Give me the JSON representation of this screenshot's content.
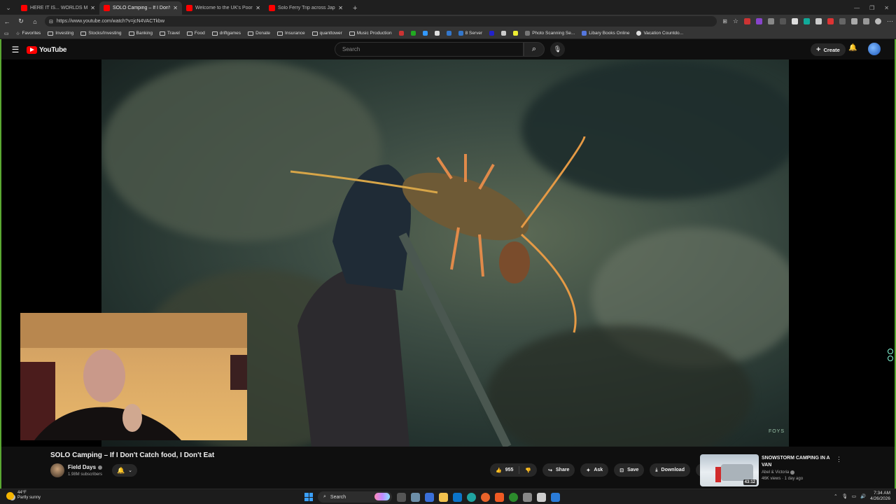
{
  "browser": {
    "tabs": [
      {
        "title": "HERE IT IS... WORLDS MOST INSANE",
        "color": "#ff0000",
        "active": false
      },
      {
        "title": "SOLO Camping – If I Don't Catch Fo",
        "color": "#ff0000",
        "active": true
      },
      {
        "title": "Welcome to the UK's Poorest Town",
        "color": "#ff0000",
        "active": false
      },
      {
        "title": "Solo Ferry Trip across Japan (Kago",
        "color": "#ff0000",
        "active": false
      }
    ],
    "new_tab_label": "+",
    "url": "https://www.youtube.com/watch?v=jcN4VACTkbw",
    "bookmarks": [
      {
        "label": "Favorites",
        "icon": "star-icon"
      },
      {
        "label": "Investing",
        "icon": "folder-icon"
      },
      {
        "label": "Stocks/Investing",
        "icon": "folder-icon"
      },
      {
        "label": "Banking",
        "icon": "folder-icon"
      },
      {
        "label": "Travel",
        "icon": "folder-icon"
      },
      {
        "label": "Food",
        "icon": "folder-icon"
      },
      {
        "label": "driftgames",
        "icon": "folder-icon"
      },
      {
        "label": "Donate",
        "icon": "folder-icon"
      },
      {
        "label": "Insurance",
        "icon": "folder-icon"
      },
      {
        "label": "quanttower",
        "icon": "folder-icon"
      },
      {
        "label": "Music Production",
        "icon": "folder-icon"
      }
    ],
    "bookmarks_right": [
      {
        "label": "8 Server",
        "icon": "server-icon"
      },
      {
        "label": "Photo Scanning Se...",
        "icon": "scan-icon"
      },
      {
        "label": "Libary Books Online",
        "icon": "library-icon"
      },
      {
        "label": "Vacation Countdo...",
        "icon": "clock-icon"
      }
    ]
  },
  "youtube": {
    "logo_text": "YouTube",
    "search_placeholder": "Search",
    "create_label": "Create",
    "video": {
      "title": "SOLO Camping – If I Don't Catch food, I Don't Eat",
      "watermark": "FOYS",
      "channel": "Field Days",
      "subscribers": "1.98M subscribers",
      "likes": "955",
      "share_label": "Share",
      "ask_label": "Ask",
      "save_label": "Save",
      "download_label": "Download"
    },
    "recommended": {
      "title": "SNOWSTORM CAMPING IN A VAN",
      "channel": "Abel & Victoria",
      "meta": "46K views · 1 day ago",
      "duration": "43:12"
    }
  },
  "taskbar": {
    "temperature": "44°F",
    "weather": "Partly sunny",
    "search_label": "Search",
    "time": "7:34 AM",
    "date": "4/26/2026"
  },
  "colors": {
    "accent": "#ff0000",
    "frame": "#5aa832"
  }
}
